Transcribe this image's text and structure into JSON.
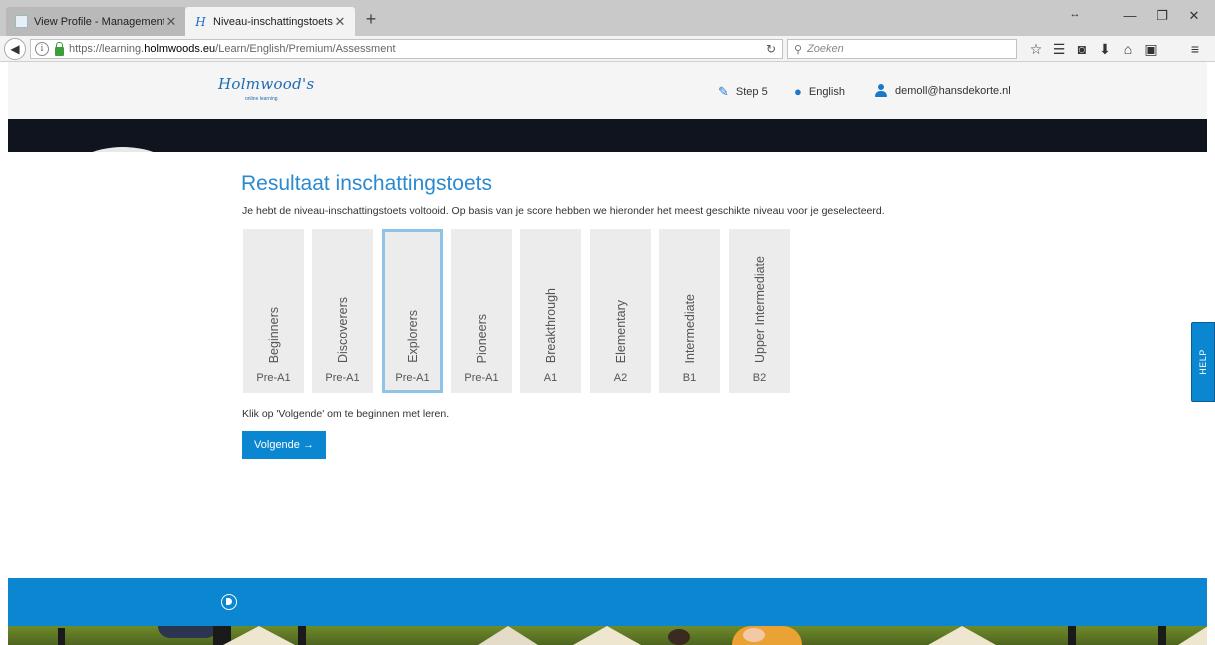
{
  "browser": {
    "tabs": [
      {
        "title": "View Profile - Management",
        "active": false
      },
      {
        "title": "Niveau-inschattingstoets -...",
        "active": true
      }
    ],
    "new_tab": "+",
    "url_prefix": "https://learning.",
    "url_domain": "holmwoods.eu",
    "url_path": "/Learn/English/Premium/Assessment",
    "search_placeholder": "Zoeken"
  },
  "header": {
    "logo": "Holmwood's",
    "logo_sub": "online learning",
    "step": "Step 5",
    "language": "English",
    "user": "demoll@hansdekorte.nl"
  },
  "main": {
    "title": "Resultaat inschattingstoets",
    "intro": "Je hebt de niveau-inschattingstoets voltooid. Op basis van je score hebben we hieronder het meest geschikte niveau voor je geselecteerd.",
    "levels": [
      {
        "name": "Beginners",
        "code": "Pre-A1",
        "selected": false
      },
      {
        "name": "Discoverers",
        "code": "Pre-A1",
        "selected": false
      },
      {
        "name": "Explorers",
        "code": "Pre-A1",
        "selected": true
      },
      {
        "name": "Pioneers",
        "code": "Pre-A1",
        "selected": false
      },
      {
        "name": "Breakthrough",
        "code": "A1",
        "selected": false
      },
      {
        "name": "Elementary",
        "code": "A2",
        "selected": false
      },
      {
        "name": "Intermediate",
        "code": "B1",
        "selected": false
      },
      {
        "name": "Upper Intermediate",
        "code": "B2",
        "selected": false
      }
    ],
    "instruction": "Klik op 'Volgende' om te beginnen met leren.",
    "next_label": "Volgende →"
  },
  "help": {
    "label": "HELP"
  },
  "colors": {
    "accent": "#0b86d1",
    "title": "#2a8ad0",
    "selected_border": "#8fc3e8",
    "card_bg": "#ececec",
    "dark_band": "#10141e",
    "footer_art": "#556b22"
  }
}
